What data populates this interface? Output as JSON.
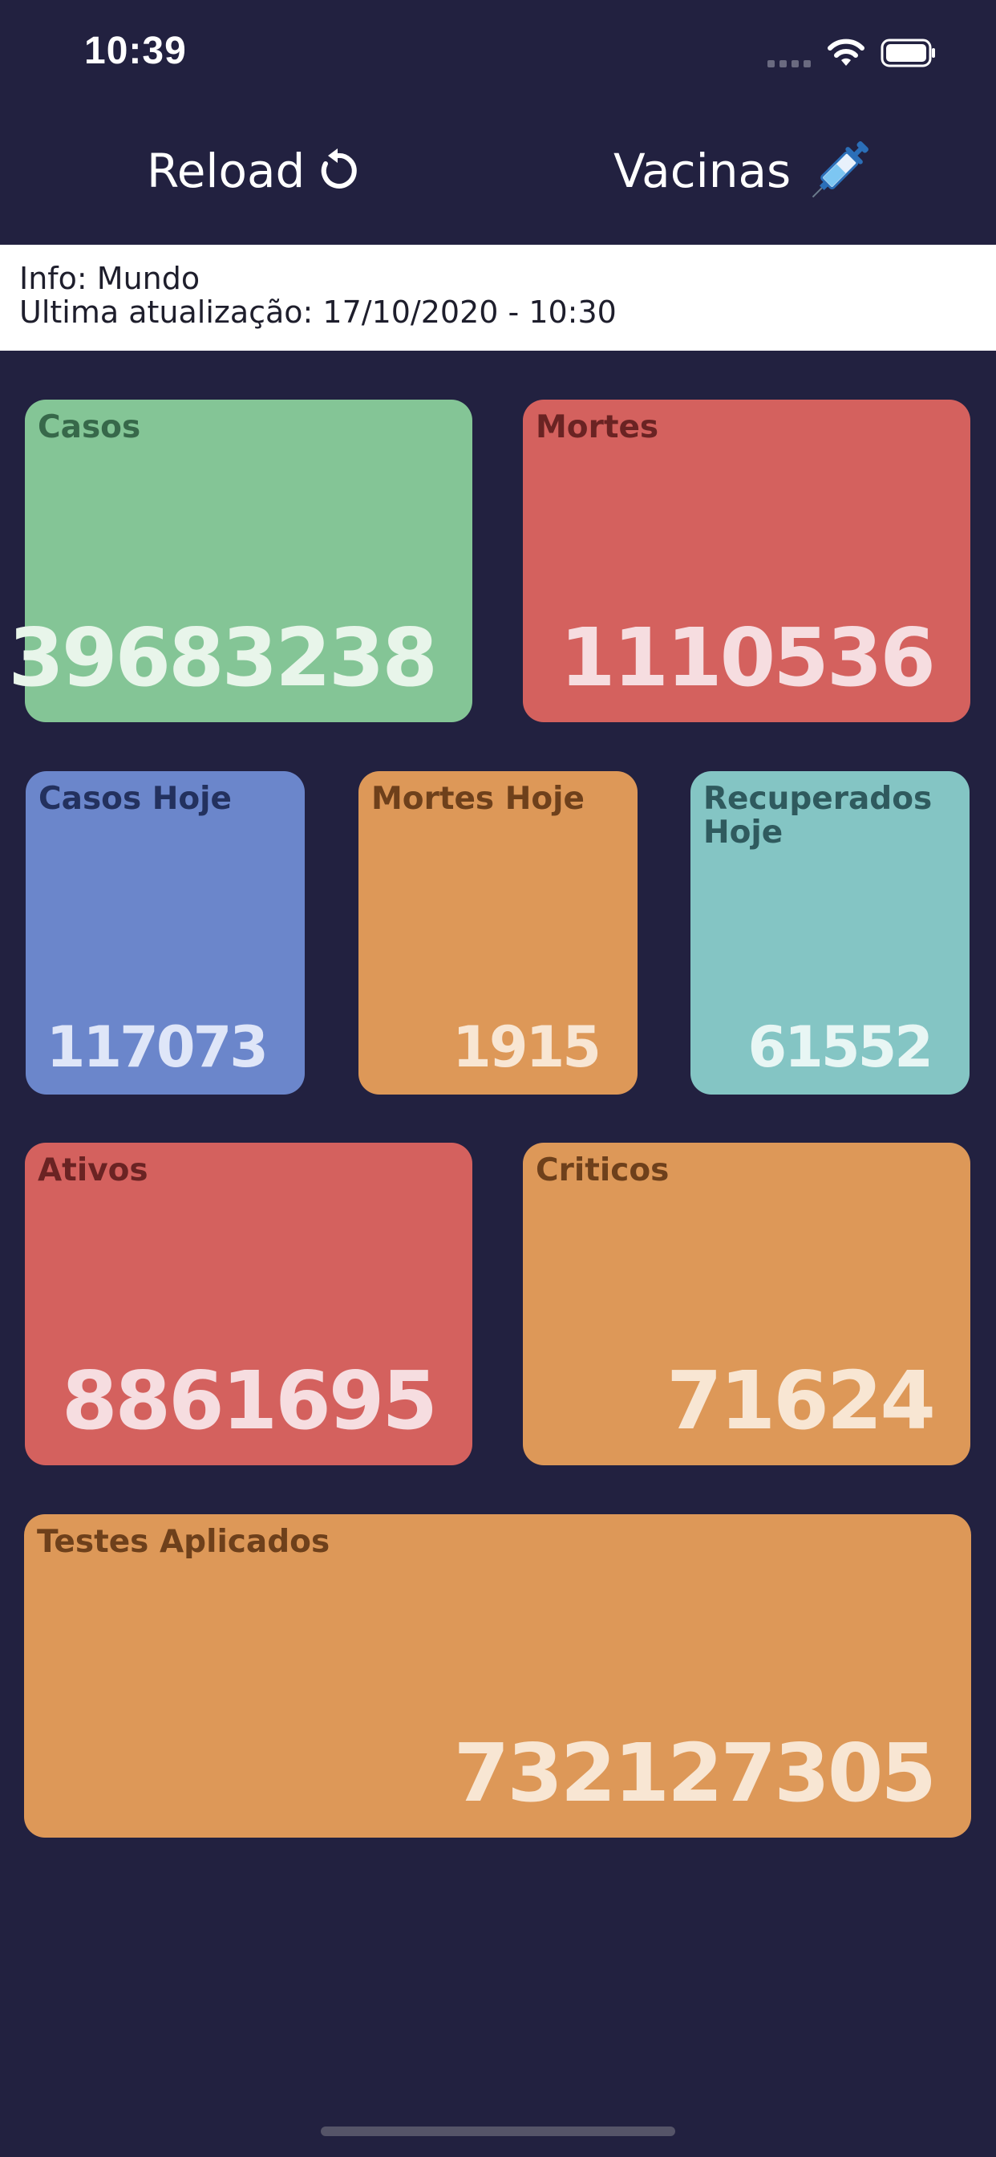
{
  "status": {
    "time": "10:39"
  },
  "nav": {
    "reload_label": "Reload",
    "reload_icon": "reload-icon",
    "vacinas_label": "Vacinas",
    "vacinas_icon": "syringe-icon"
  },
  "info": {
    "line1": "Info: Mundo",
    "line2": "Ultima atualização: 17/10/2020 - 10:30"
  },
  "cards": [
    {
      "label": "Casos",
      "value": "39683238",
      "color": "#84c596"
    },
    {
      "label": "Mortes",
      "value": "1110536",
      "color": "#d4615e"
    },
    {
      "label": "Casos Hoje",
      "value": "117073",
      "color": "#6b86cb"
    },
    {
      "label": "Mortes Hoje",
      "value": "1915",
      "color": "#dd9858"
    },
    {
      "label": "Recuperados Hoje",
      "value": "61552",
      "color": "#84c5c4"
    },
    {
      "label": "Ativos",
      "value": "8861695",
      "color": "#d4615e"
    },
    {
      "label": "Criticos",
      "value": "71624",
      "color": "#dd9858"
    },
    {
      "label": "Testes Aplicados",
      "value": "732127305",
      "color": "#dd9858"
    }
  ]
}
